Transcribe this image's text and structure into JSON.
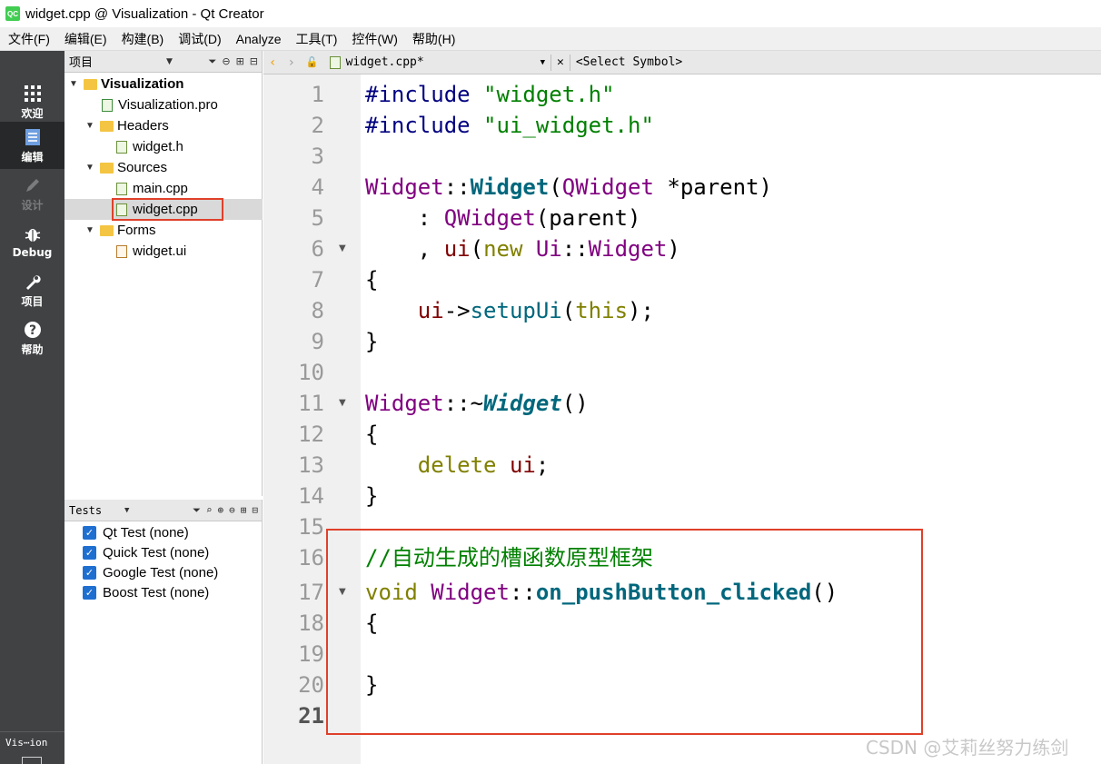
{
  "window": {
    "title": "widget.cpp @ Visualization - Qt Creator",
    "app_icon": "QC"
  },
  "menu": [
    "文件(F)",
    "编辑(E)",
    "构建(B)",
    "调试(D)",
    "Analyze",
    "工具(T)",
    "控件(W)",
    "帮助(H)"
  ],
  "modes": [
    {
      "label": "欢迎",
      "icon": "grid-icon"
    },
    {
      "label": "编辑",
      "icon": "document-icon"
    },
    {
      "label": "设计",
      "icon": "pencil-icon"
    },
    {
      "label": "Debug",
      "icon": "bug-icon"
    },
    {
      "label": "项目",
      "icon": "wrench-icon"
    },
    {
      "label": "帮助",
      "icon": "help-icon"
    }
  ],
  "mode_bottom_label": "Vis⋯ion",
  "project_pane": {
    "title": "项目",
    "tree": [
      {
        "label": "Visualization"
      },
      {
        "label": "Visualization.pro"
      },
      {
        "label": "Headers"
      },
      {
        "label": "widget.h"
      },
      {
        "label": "Sources"
      },
      {
        "label": "main.cpp"
      },
      {
        "label": "widget.cpp"
      },
      {
        "label": "Forms"
      },
      {
        "label": "widget.ui"
      }
    ]
  },
  "tests_pane": {
    "title": "Tests",
    "items": [
      "Qt Test (none)",
      "Quick Test (none)",
      "Google Test (none)",
      "Boost Test (none)"
    ]
  },
  "editor_toolbar": {
    "file": "widget.cpp*",
    "symbol": "<Select Symbol>"
  },
  "editor": {
    "line_numbers": [
      "1",
      "2",
      "3",
      "4",
      "5",
      "6",
      "7",
      "8",
      "9",
      "10",
      "11",
      "12",
      "13",
      "14",
      "15",
      "16",
      "17",
      "18",
      "19",
      "20",
      "21"
    ],
    "current_line": "21",
    "tokens": {
      "l1a": "#include ",
      "l1b": "\"widget.h\"",
      "l2a": "#include ",
      "l2b": "\"ui_widget.h\"",
      "l4a": "Widget",
      "l4b": "::",
      "l4c": "Widget",
      "l4d": "(",
      "l4e": "QWidget",
      "l4f": " *parent)",
      "l5a": "    : ",
      "l5b": "QWidget",
      "l5c": "(parent)",
      "l6a": "    , ",
      "l6b": "ui",
      "l6c": "(",
      "l6d": "new ",
      "l6e": "Ui",
      "l6f": "::",
      "l6g": "Widget",
      "l6h": ")",
      "l7": "{",
      "l8a": "    ",
      "l8b": "ui",
      "l8c": "->",
      "l8d": "setupUi",
      "l8e": "(",
      "l8f": "this",
      "l8g": ");",
      "l9": "}",
      "l11a": "Widget",
      "l11b": "::~",
      "l11c": "Widget",
      "l11d": "()",
      "l12": "{",
      "l13a": "    ",
      "l13b": "delete ",
      "l13c": "ui",
      "l13d": ";",
      "l14": "}",
      "l16": "//自动生成的槽函数原型框架",
      "l17a": "void ",
      "l17b": "Widget",
      "l17c": "::",
      "l17d": "on_pushButton_clicked",
      "l17e": "()",
      "l18": "{",
      "l20": "}"
    }
  },
  "watermark": "CSDN @艾莉丝努力练剑",
  "colors": {
    "highlight_box": "#e0402a",
    "mode_bar": "#404244",
    "keyword_olive": "#808000",
    "class_purple": "#800080",
    "string_green": "#008000"
  }
}
